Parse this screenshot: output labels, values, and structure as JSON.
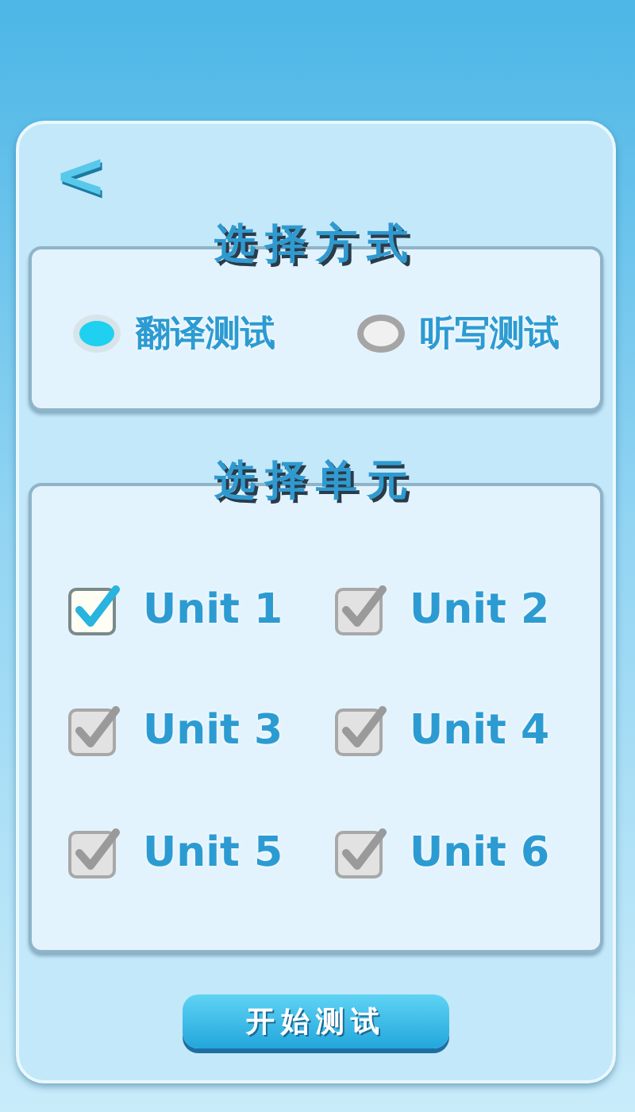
{
  "back_button": {
    "label": "<"
  },
  "mode_section": {
    "title": "选择方式",
    "options": [
      {
        "label": "翻译测试",
        "selected": true
      },
      {
        "label": "听写测试",
        "selected": false
      }
    ]
  },
  "unit_section": {
    "title": "选择单元",
    "units": [
      {
        "label": "Unit 1",
        "checked": true
      },
      {
        "label": "Unit 2",
        "checked": false
      },
      {
        "label": "Unit 3",
        "checked": false
      },
      {
        "label": "Unit 4",
        "checked": false
      },
      {
        "label": "Unit 5",
        "checked": false
      },
      {
        "label": "Unit 6",
        "checked": false
      }
    ]
  },
  "start_button": {
    "label": "开始测试"
  }
}
